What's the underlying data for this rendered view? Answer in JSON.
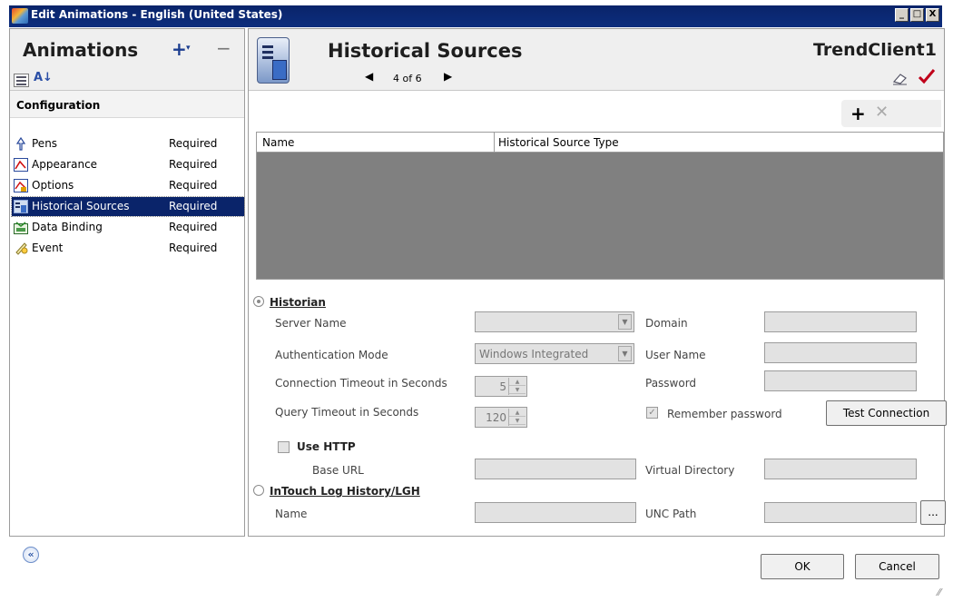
{
  "window": {
    "title": "Edit Animations - English (United States)",
    "minimize": "_",
    "maximize": "□",
    "close": "X"
  },
  "left": {
    "title": "Animations",
    "add": "+",
    "add_dropdown": "▾",
    "remove": "−",
    "sort_label": "A↓",
    "config_header": "Configuration",
    "items": [
      {
        "name": "Pens",
        "status": "Required",
        "icon": "pen-icon",
        "selected": false
      },
      {
        "name": "Appearance",
        "status": "Required",
        "icon": "appearance-icon",
        "selected": false
      },
      {
        "name": "Options",
        "status": "Required",
        "icon": "options-icon",
        "selected": false
      },
      {
        "name": "Historical Sources",
        "status": "Required",
        "icon": "historical-sources-icon",
        "selected": true
      },
      {
        "name": "Data Binding",
        "status": "Required",
        "icon": "data-binding-icon",
        "selected": false
      },
      {
        "name": "Event",
        "status": "Required",
        "icon": "event-icon",
        "selected": false
      }
    ]
  },
  "right": {
    "title": "Historical Sources",
    "object_name": "TrendClient1",
    "nav": {
      "prev": "◀",
      "count": "4 of 6",
      "next": "▶"
    },
    "add": "+",
    "remove": "✕",
    "grid": {
      "columns": [
        "Name",
        "Historical Source Type"
      ]
    },
    "historian": {
      "label": "Historian",
      "server_name_label": "Server Name",
      "server_name_value": "",
      "auth_mode_label": "Authentication Mode",
      "auth_mode_value": "Windows Integrated",
      "conn_timeout_label": "Connection Timeout in Seconds",
      "conn_timeout_value": "5",
      "query_timeout_label": "Query Timeout in Seconds",
      "query_timeout_value": "120",
      "domain_label": "Domain",
      "user_name_label": "User Name",
      "password_label": "Password",
      "remember_password_label": "Remember password",
      "test_connection_label": "Test Connection",
      "use_http_label": "Use HTTP",
      "base_url_label": "Base URL",
      "virtual_directory_label": "Virtual Directory"
    },
    "intouch": {
      "label": "InTouch Log History/LGH",
      "name_label": "Name",
      "unc_path_label": "UNC Path",
      "browse_label": "..."
    }
  },
  "footer": {
    "ok": "OK",
    "cancel": "Cancel",
    "collapse": "«"
  },
  "colors": {
    "selection": "#0a246a",
    "titlebar": "#0a246a",
    "grid_body": "#808080",
    "accept_check": "#c0001a"
  }
}
